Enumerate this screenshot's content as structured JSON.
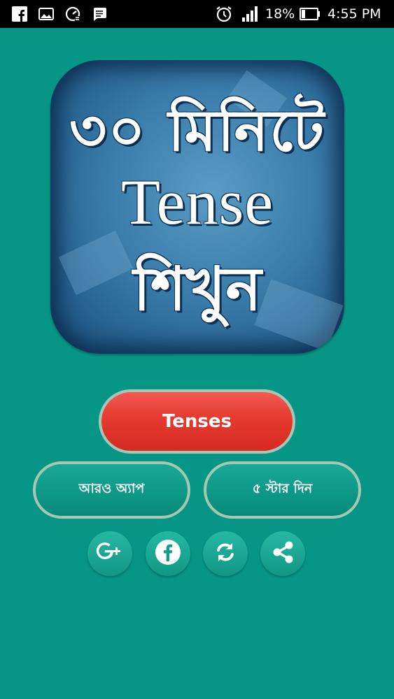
{
  "status_bar": {
    "battery_percent": "18%",
    "time": "4:55 PM",
    "icons": [
      "facebook-icon",
      "gallery-icon",
      "speed-icon",
      "message-icon",
      "alarm-icon",
      "signal-icon",
      "battery-icon"
    ]
  },
  "logo": {
    "line1": "৩০ মিনিটে",
    "line2": "Tense",
    "line3": "শিখুন"
  },
  "buttons": {
    "tenses": "Tenses",
    "more_apps": "আরও অ্যাপ",
    "rate": "৫ স্টার দিন"
  },
  "share_row": {
    "google_plus_icon": "google-plus-icon",
    "facebook_icon": "facebook-icon",
    "refresh_icon": "refresh-icon",
    "share_icon": "share-icon"
  },
  "colors": {
    "background": "#079686",
    "tenses_button": "#e53a2f",
    "teal_button": "#0e9a88",
    "button_border": "#a7c7b6",
    "status_bar": "#000000"
  }
}
